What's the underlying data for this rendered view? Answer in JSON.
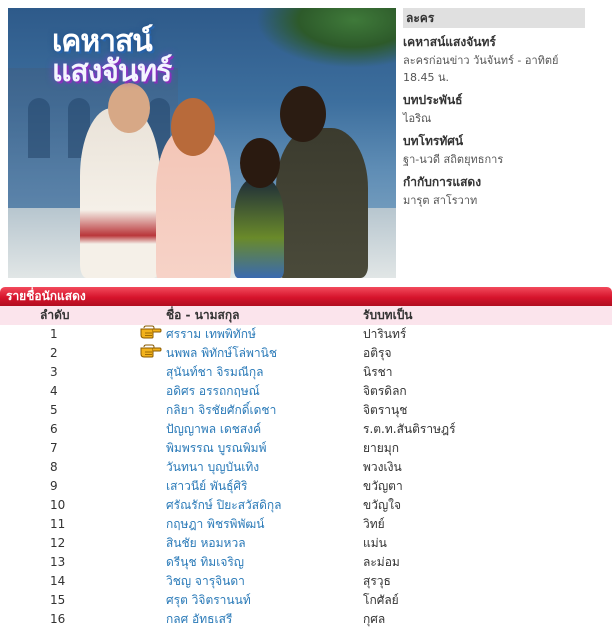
{
  "poster": {
    "title_line1": "เคหาสน์",
    "title_line2": "แสงจันทร์"
  },
  "info": {
    "category_header": "ละคร",
    "show_title": "เคหาสน์แสงจันทร์",
    "airtime": "ละครก่อนข่าว วันจันทร์ - อาทิตย์ 18.45 น.",
    "writer_label": "บทประพันธ์",
    "writer": "ไอริณ",
    "screenplay_label": "บทโทรทัศน์",
    "screenplay": "ฐา-นวดี สถิตยุทธการ",
    "director_label": "กำกับการแสดง",
    "director": "มารุต สาโรวาท"
  },
  "cast": {
    "title": "รายชื่อนักแสดง",
    "col_number": "ลำดับ",
    "col_name": "ชื่อ - นามสกุล",
    "col_role": "รับบทเป็น",
    "pointer_icon": "pointing-hand-icon",
    "rows": [
      {
        "num": "1",
        "name": "ศรราม เทพพิทักษ์",
        "role": "ปารินทร์",
        "featured": true
      },
      {
        "num": "2",
        "name": "นพพล พิทักษ์โล่พานิช",
        "role": "อติรุจ",
        "featured": true
      },
      {
        "num": "3",
        "name": "สุนันท์ชา จิรมณีกุล",
        "role": "นิรชา",
        "featured": false
      },
      {
        "num": "4",
        "name": "อดิศร อรรถกฤษณ์",
        "role": "จิตรดิลก",
        "featured": false
      },
      {
        "num": "5",
        "name": "กลิยา จิรชัยศักดิ์เดชา",
        "role": "จิตรานุช",
        "featured": false
      },
      {
        "num": "6",
        "name": "ปัญญาพล เดชสงค์",
        "role": "ร.ต.ท.สันติราษฎร์",
        "featured": false
      },
      {
        "num": "7",
        "name": "พิมพรรณ บูรณพิมพ์",
        "role": "ยายมุก",
        "featured": false
      },
      {
        "num": "8",
        "name": "วันทนา บุญบันเทิง",
        "role": "พวงเงิน",
        "featured": false
      },
      {
        "num": "9",
        "name": "เสาวนีย์ พันธุ์ศิริ",
        "role": "ขวัญตา",
        "featured": false
      },
      {
        "num": "10",
        "name": "ศรัณรักษ์ ปิยะสวัสดิกุล",
        "role": "ขวัญใจ",
        "featured": false
      },
      {
        "num": "11",
        "name": "กฤษฎา พิชรพิพัฒน์",
        "role": "วิทย์",
        "featured": false
      },
      {
        "num": "12",
        "name": "สินชัย หอมหวล",
        "role": "แม่น",
        "featured": false
      },
      {
        "num": "13",
        "name": "ดรีนุช ทิมเจริญ",
        "role": "ละม่อม",
        "featured": false
      },
      {
        "num": "14",
        "name": "วิชญ จารุจินดา",
        "role": "สุรวุธ",
        "featured": false
      },
      {
        "num": "15",
        "name": "ศรุต วิจิตรานนท์",
        "role": "โกศัลย์",
        "featured": false
      },
      {
        "num": "16",
        "name": "กลศ อัทธเสรี",
        "role": "กุศล",
        "featured": false
      }
    ]
  }
}
